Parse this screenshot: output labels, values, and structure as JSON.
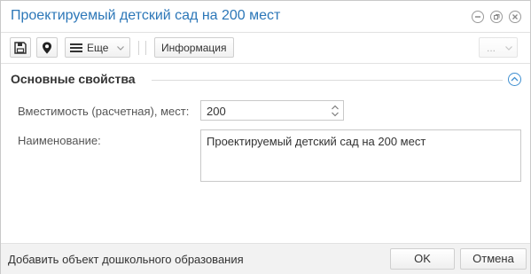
{
  "window": {
    "title": "Проектируемый детский сад на 200 мест"
  },
  "toolbar": {
    "more_label": "Еще",
    "info_label": "Информация",
    "extra_label": "..."
  },
  "section": {
    "title": "Основные свойства"
  },
  "fields": {
    "capacity_label": "Вместимость (расчетная), мест:",
    "capacity_value": "200",
    "name_label": "Наименование:",
    "name_value": "Проектируемый детский сад на 200 мест"
  },
  "footer": {
    "status": "Добавить объект дошкольного образования",
    "ok_label": "OK",
    "cancel_label": "Отмена"
  },
  "colors": {
    "title": "#2c77b8",
    "accent": "#3f8fd0",
    "footer_bg": "#f2f2f2"
  },
  "icons": [
    "save-icon",
    "location-pin-icon",
    "menu-icon",
    "chevron-down-icon",
    "minimize-icon",
    "restore-icon",
    "close-icon",
    "chevron-up-icon",
    "spinner-icon"
  ]
}
